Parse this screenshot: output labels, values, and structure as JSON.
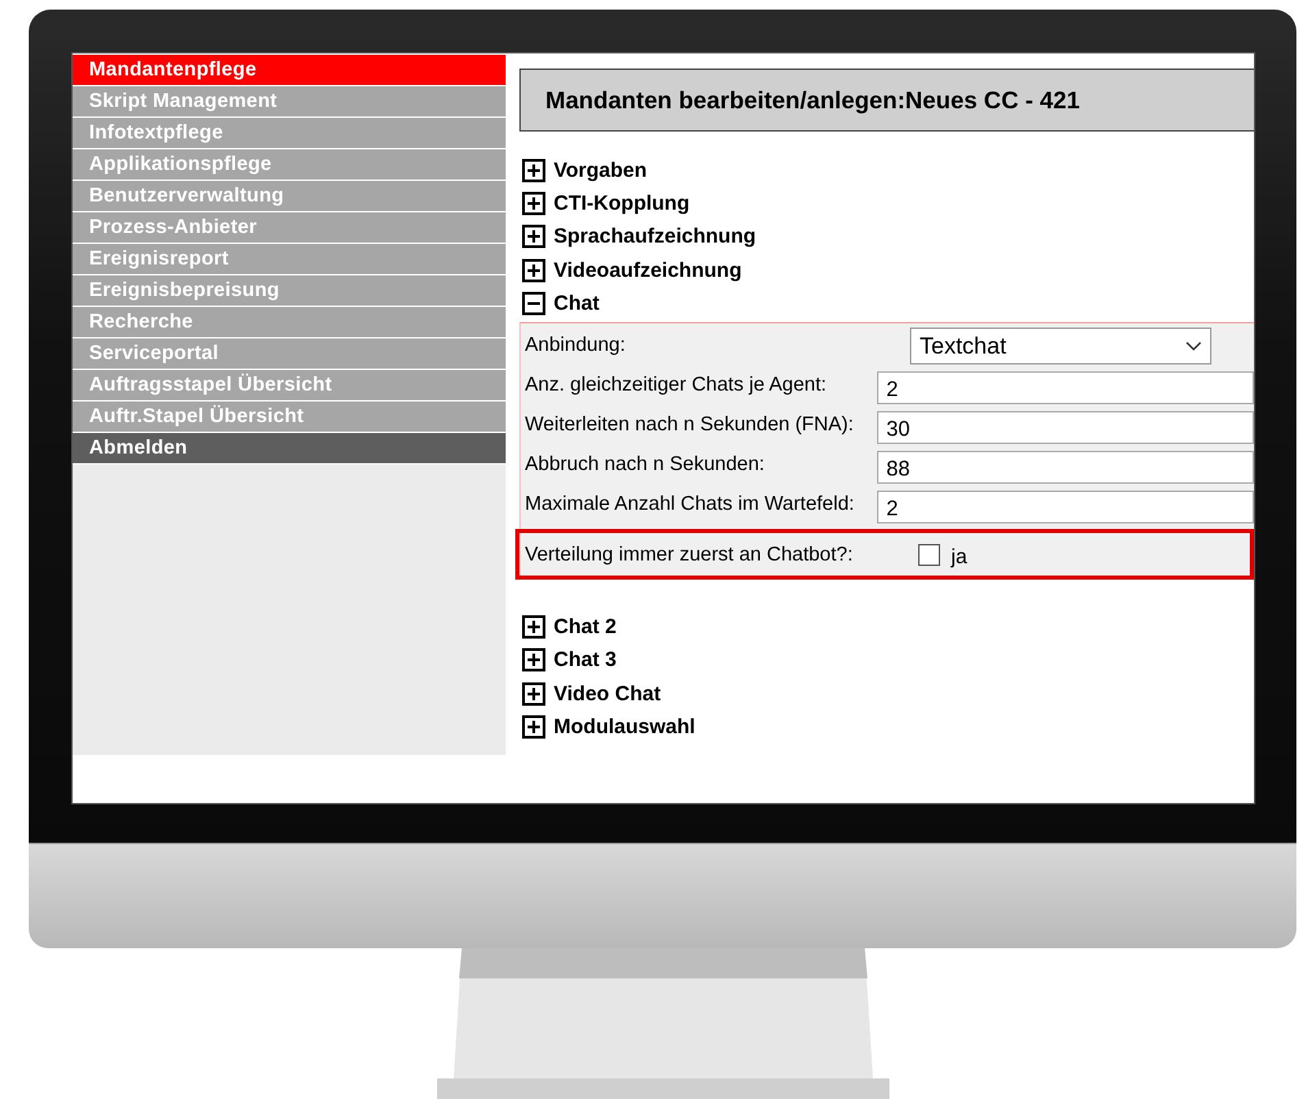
{
  "sidebar": {
    "items": [
      {
        "label": "Mandantenpflege",
        "selected": true,
        "kind": "menu"
      },
      {
        "label": "Skript Management",
        "selected": false,
        "kind": "menu"
      },
      {
        "label": "Infotextpflege",
        "selected": false,
        "kind": "menu"
      },
      {
        "label": "Applikationspflege",
        "selected": false,
        "kind": "menu"
      },
      {
        "label": "Benutzerverwaltung",
        "selected": false,
        "kind": "menu"
      },
      {
        "label": "Prozess-Anbieter",
        "selected": false,
        "kind": "menu"
      },
      {
        "label": "Ereignisreport",
        "selected": false,
        "kind": "menu"
      },
      {
        "label": "Ereignisbepreisung",
        "selected": false,
        "kind": "menu"
      },
      {
        "label": "Recherche",
        "selected": false,
        "kind": "menu"
      },
      {
        "label": "Serviceportal",
        "selected": false,
        "kind": "menu"
      },
      {
        "label": "Auftragsstapel Übersicht",
        "selected": false,
        "kind": "menu"
      },
      {
        "label": "Auftr.Stapel Übersicht",
        "selected": false,
        "kind": "menu"
      },
      {
        "label": "Abmelden",
        "selected": false,
        "kind": "logout"
      }
    ]
  },
  "page_title": "Mandanten bearbeiten/anlegen:Neues CC - 421",
  "sections": [
    {
      "label": "Vorgaben",
      "expanded": false
    },
    {
      "label": "CTI-Kopplung",
      "expanded": false
    },
    {
      "label": "Sprachaufzeichnung",
      "expanded": false
    },
    {
      "label": "Videoaufzeichnung",
      "expanded": false
    },
    {
      "label": "Chat",
      "expanded": true,
      "fields": [
        {
          "kind": "select",
          "label": "Anbindung:",
          "value": "Textchat",
          "highlighted": false
        },
        {
          "kind": "text",
          "label": "Anz. gleichzeitiger Chats je Agent:",
          "value": "2",
          "highlighted": false
        },
        {
          "kind": "text",
          "label": "Weiterleiten nach n Sekunden (FNA):",
          "value": "30",
          "highlighted": false
        },
        {
          "kind": "text",
          "label": "Abbruch nach n Sekunden:",
          "value": "88",
          "highlighted": false
        },
        {
          "kind": "text",
          "label": "Maximale Anzahl Chats im Wartefeld:",
          "value": "2",
          "highlighted": false
        },
        {
          "kind": "checkbox",
          "label": "Verteilung immer zuerst an Chatbot?:",
          "option": "ja",
          "checked": false,
          "highlighted": true
        }
      ]
    },
    {
      "label": "Chat 2",
      "expanded": false
    },
    {
      "label": "Chat 3",
      "expanded": false
    },
    {
      "label": "Video Chat",
      "expanded": false
    },
    {
      "label": "Modulauswahl",
      "expanded": false
    }
  ]
}
